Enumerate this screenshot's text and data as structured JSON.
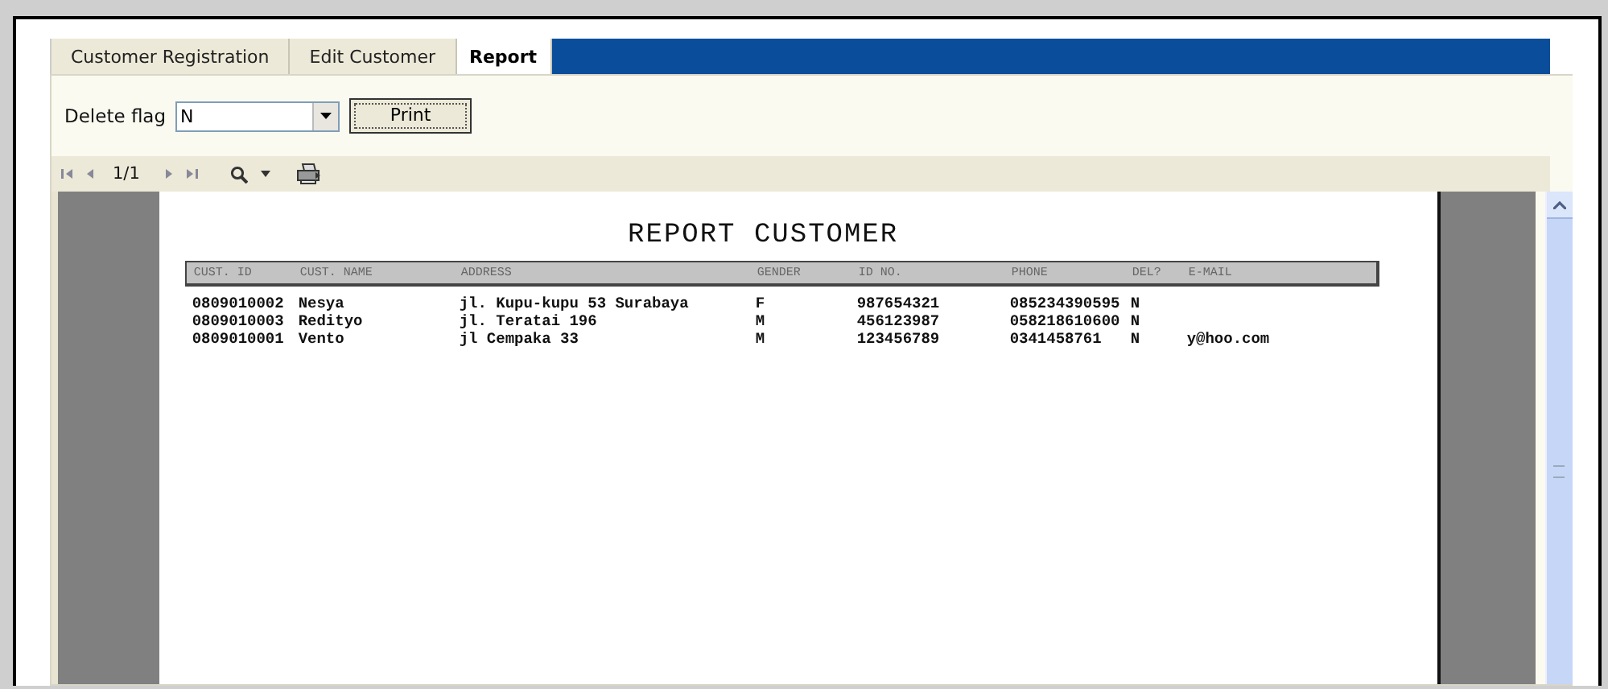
{
  "tabs": [
    {
      "label": "Customer Registration",
      "selected": false
    },
    {
      "label": "Edit Customer",
      "selected": false
    },
    {
      "label": "Report",
      "selected": true
    }
  ],
  "filter": {
    "label": "Delete flag",
    "value": "N",
    "button": "Print"
  },
  "viewer_toolbar": {
    "page": "1/1"
  },
  "report": {
    "title": "REPORT CUSTOMER",
    "columns": [
      "CUST. ID",
      "CUST. NAME",
      "ADDRESS",
      "GENDER",
      "ID NO.",
      "PHONE",
      "DEL?",
      "E-MAIL"
    ],
    "rows": [
      [
        "0809010002",
        "Nesya",
        "jl. Kupu-kupu 53 Surabaya",
        "F",
        "987654321",
        "085234390595",
        "N",
        ""
      ],
      [
        "0809010003",
        "Redityo",
        "jl. Teratai 196",
        "M",
        "456123987",
        "058218610600",
        "N",
        ""
      ],
      [
        "0809010001",
        "Vento",
        "jl Cempaka 33",
        "M",
        "123456789",
        "0341458761",
        "N",
        "y@hoo.com"
      ]
    ]
  }
}
